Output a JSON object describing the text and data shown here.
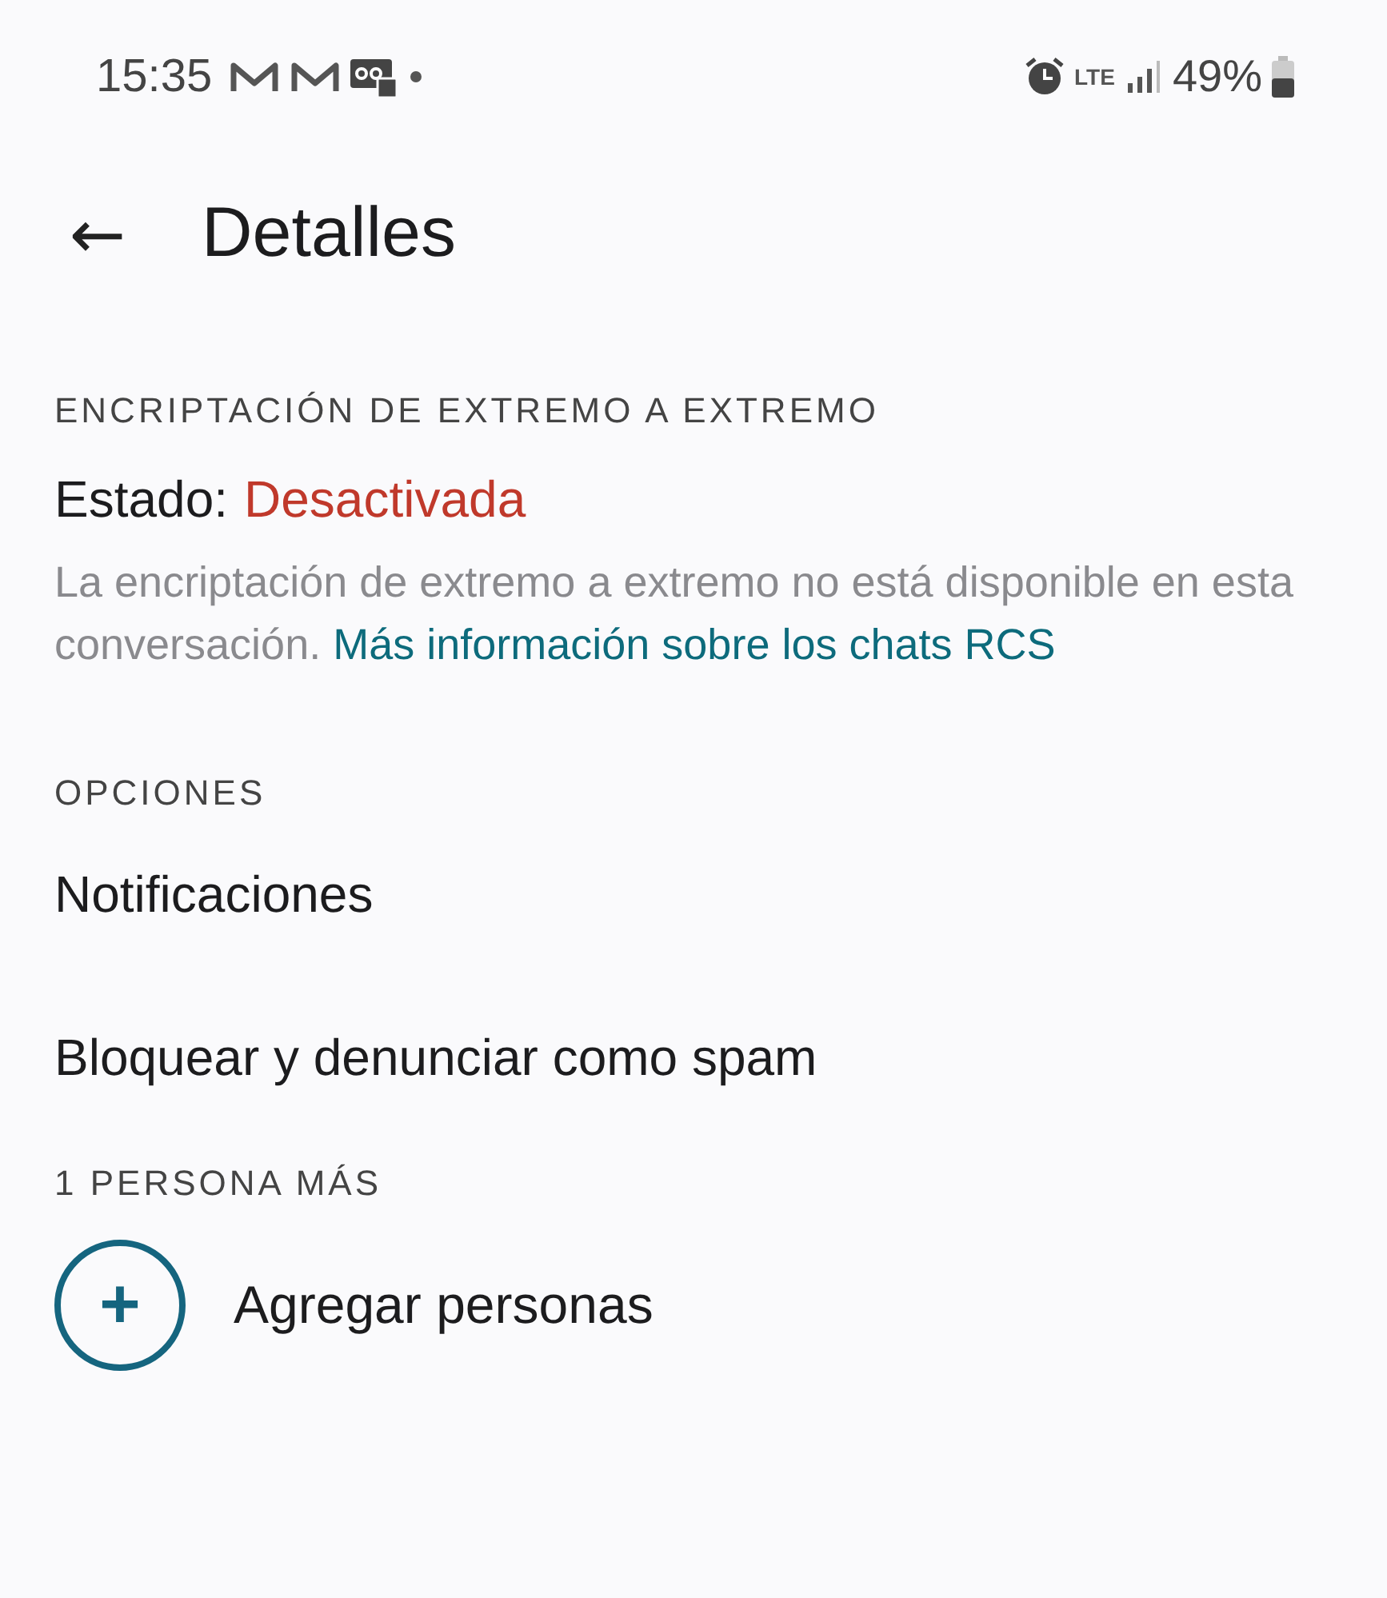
{
  "status_bar": {
    "time": "15:35",
    "network": "LTE",
    "battery": "49%"
  },
  "header": {
    "back_icon": "←",
    "title": "Detalles"
  },
  "encryption": {
    "heading": "ENCRIPTACIÓN DE EXTREMO A EXTREMO",
    "status_label": "Estado:",
    "status_value": "Desactivada",
    "description": "La encriptación de extremo a extremo no está disponible en esta conversación.",
    "link": "Más información sobre los chats RCS"
  },
  "options": {
    "heading": "OPCIONES",
    "items": [
      "Notificaciones",
      "Bloquear y denunciar como spam"
    ]
  },
  "people": {
    "heading": "1 PERSONA MÁS",
    "add_icon": "+",
    "add_label": "Agregar personas"
  }
}
